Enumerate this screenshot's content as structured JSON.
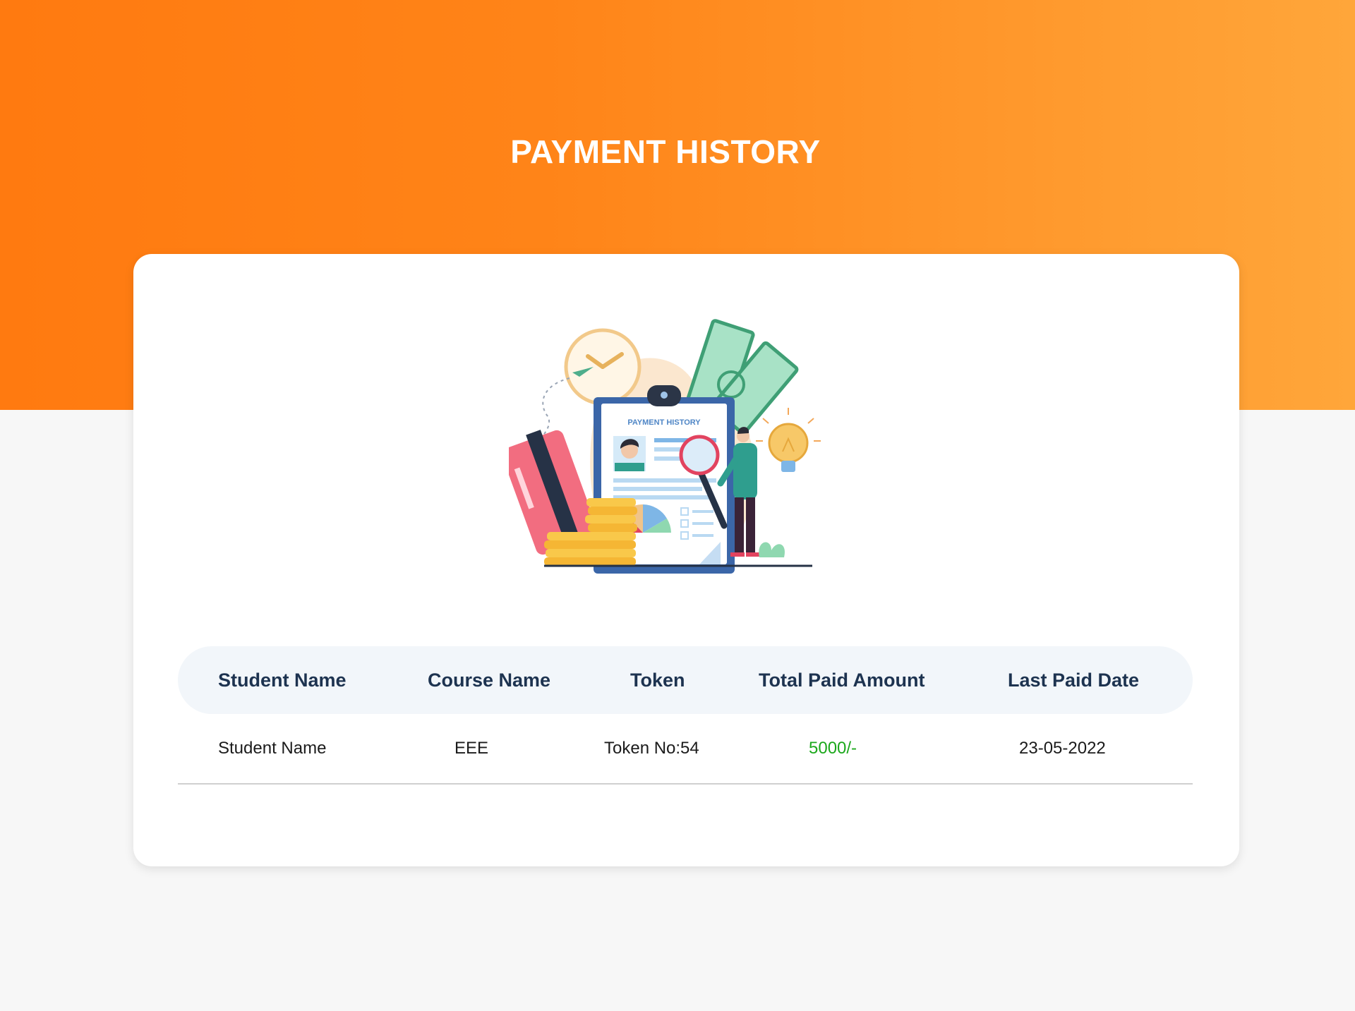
{
  "page": {
    "title": "PAYMENT HISTORY"
  },
  "illustration": {
    "document_heading": "PAYMENT HISTORY",
    "icon": "payment-history-illustration"
  },
  "table": {
    "headers": [
      "Student Name",
      "Course Name",
      "Token",
      "Total Paid Amount",
      "Last Paid Date"
    ],
    "rows": [
      {
        "student_name": "Student Name",
        "course_name": "EEE",
        "token": "Token No:54",
        "total_paid_amount": "5000/-",
        "last_paid_date": "23-05-2022"
      }
    ]
  },
  "colors": {
    "header_gradient_start": "#ff7a10",
    "header_gradient_end": "#ffa63a",
    "amount_green": "#1ca81c",
    "table_header_bg": "#f2f6fa",
    "table_header_text": "#1d3350"
  }
}
